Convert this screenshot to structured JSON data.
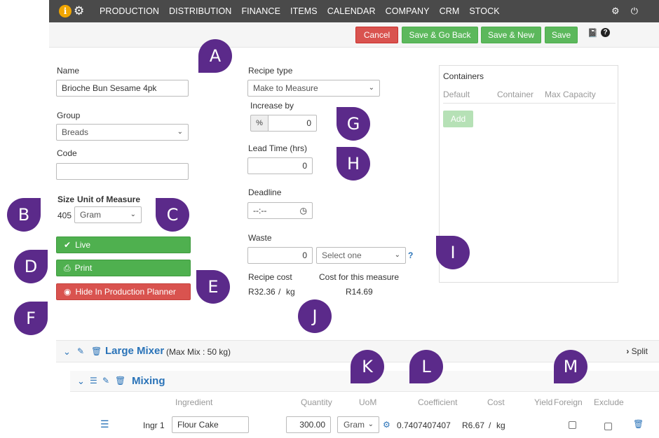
{
  "nav": {
    "items": [
      "PRODUCTION",
      "DISTRIBUTION",
      "FINANCE",
      "ITEMS",
      "CALENDAR",
      "COMPANY",
      "CRM",
      "STOCK"
    ],
    "info_glyph": "i",
    "cogs_glyph": "⚙",
    "settings_glyph": "⚙",
    "power_glyph": "⏻",
    "icons": [
      "info-icon",
      "cogs-icon",
      "gear-icon",
      "power-icon"
    ]
  },
  "toolbar": {
    "cancel": "Cancel",
    "save_go_back": "Save & Go Back",
    "save_new": "Save & New",
    "save": "Save",
    "book_glyph": "📓",
    "help_glyph": "?"
  },
  "form": {
    "name_label": "Name",
    "name_value": "Brioche Bun Sesame 4pk",
    "group_label": "Group",
    "group_value": "Breads",
    "code_label": "Code",
    "code_value": "",
    "size_label": "Size",
    "uom_label": "Unit of Measure",
    "size_value": "405",
    "uom_value": "Gram",
    "live_label": "Live",
    "print_label": "Print",
    "hide_label": "Hide In Production Planner",
    "recipe_type_label": "Recipe type",
    "recipe_type_value": "Make to Measure",
    "increase_by_label": "Increase by",
    "increase_addon": "%",
    "increase_value": "0",
    "lead_time_label": "Lead Time (hrs)",
    "lead_time_value": "0",
    "deadline_label": "Deadline",
    "deadline_value": "--:--",
    "waste_label": "Waste",
    "waste_value": "0",
    "waste_select": "Select one",
    "waste_help": "?",
    "recipe_cost_label": "Recipe cost",
    "recipe_cost_value": "R32.36",
    "recipe_cost_sep": "/",
    "recipe_cost_unit": "kg",
    "cost_measure_label": "Cost for this measure",
    "cost_measure_value": "R14.69"
  },
  "containers": {
    "title": "Containers",
    "headers": [
      "Default",
      "Container",
      "Max Capacity"
    ],
    "add": "Add"
  },
  "mixer": {
    "title": "Large Mixer",
    "subtitle": "(Max Mix : 50 kg)",
    "split": "Split",
    "section": "Mixing",
    "columns": [
      "Ingredient",
      "Quantity",
      "UoM",
      "Coefficient",
      "Cost",
      "Yield",
      "Foreign",
      "Exclude"
    ],
    "row": {
      "label": "Ingr 1",
      "ingredient": "Flour Cake",
      "quantity": "300.00",
      "uom": "Gram",
      "coefficient": "0.7407407407",
      "cost": "R6.67",
      "cost_sep": "/",
      "cost_unit": "kg"
    }
  },
  "markers": [
    "A",
    "B",
    "C",
    "D",
    "E",
    "F",
    "G",
    "H",
    "I",
    "J",
    "K",
    "L",
    "M"
  ],
  "colors": {
    "nav_bg": "#4a4a4a",
    "accent_blue": "#2a73b8",
    "green": "#5cb85c",
    "red": "#d9534f",
    "marker": "#5b2a8a"
  }
}
